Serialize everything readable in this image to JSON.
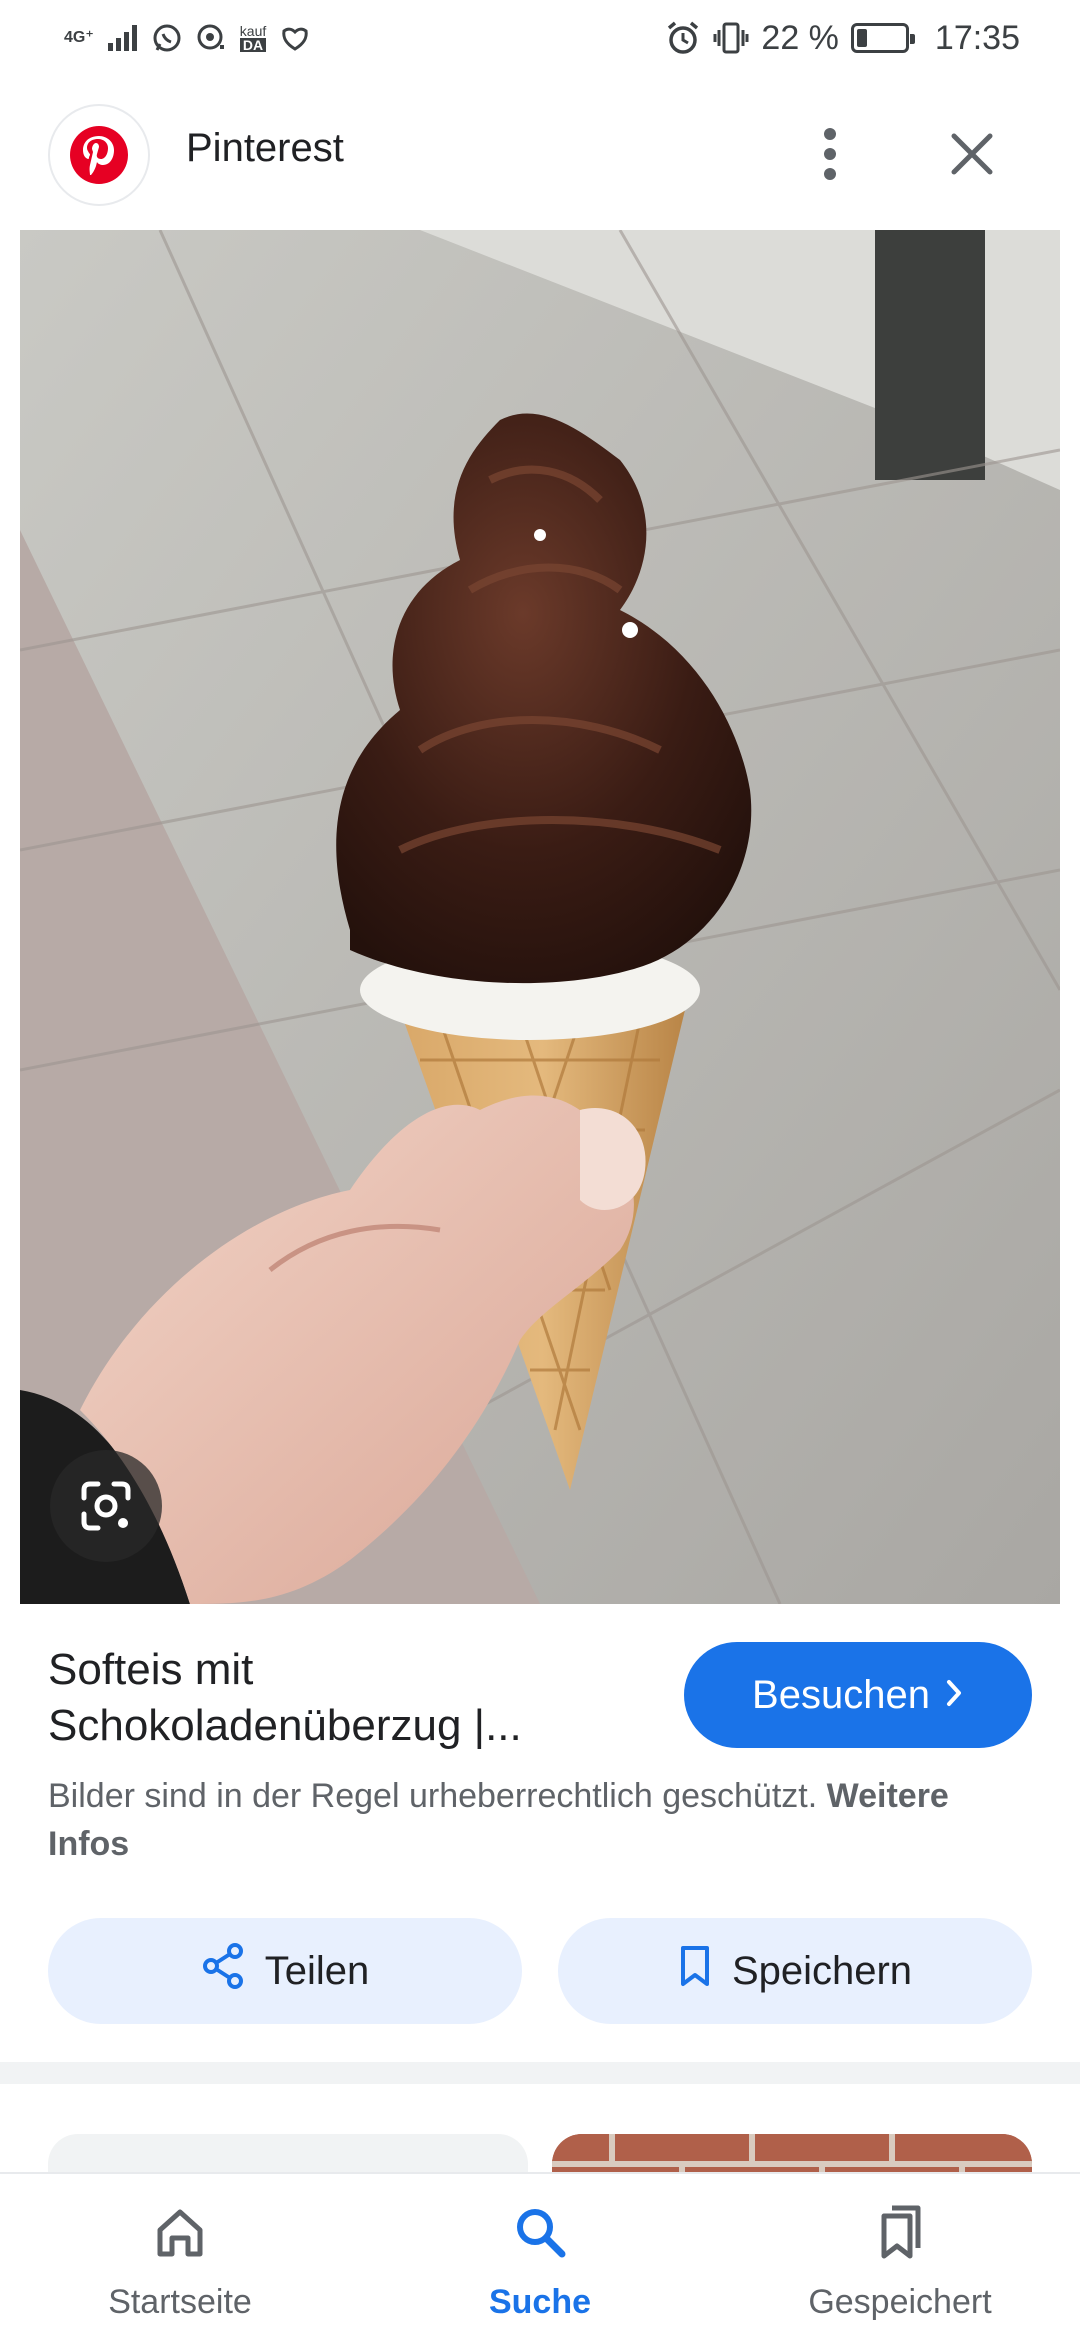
{
  "status_bar": {
    "network": "4G⁺",
    "battery_text": "22 %",
    "battery_level": 0.22,
    "time": "17:35",
    "kauf_label": "kauf",
    "da_label": "DA"
  },
  "header": {
    "title": "Pinterest",
    "logo_icon": "pinterest-logo",
    "menu_icon": "more-vert-icon",
    "close_icon": "close-icon"
  },
  "result": {
    "title": "Softeis mit Schokoladenüberzug |...",
    "visit_label": "Besuchen",
    "copyright_text": "Bilder sind in der Regel urheberrechtlich geschützt.",
    "more_info_label": "Weitere Infos",
    "share_label": "Teilen",
    "save_label": "Speichern"
  },
  "bottom_nav": {
    "items": [
      {
        "label": "Startseite",
        "icon": "home-icon",
        "active": false
      },
      {
        "label": "Suche",
        "icon": "search-icon",
        "active": true
      },
      {
        "label": "Gespeichert",
        "icon": "bookmarks-icon",
        "active": false
      }
    ]
  },
  "colors": {
    "accent": "#1a73e8",
    "pinterest_red": "#e60023",
    "chip_bg": "#e8f0fe"
  }
}
